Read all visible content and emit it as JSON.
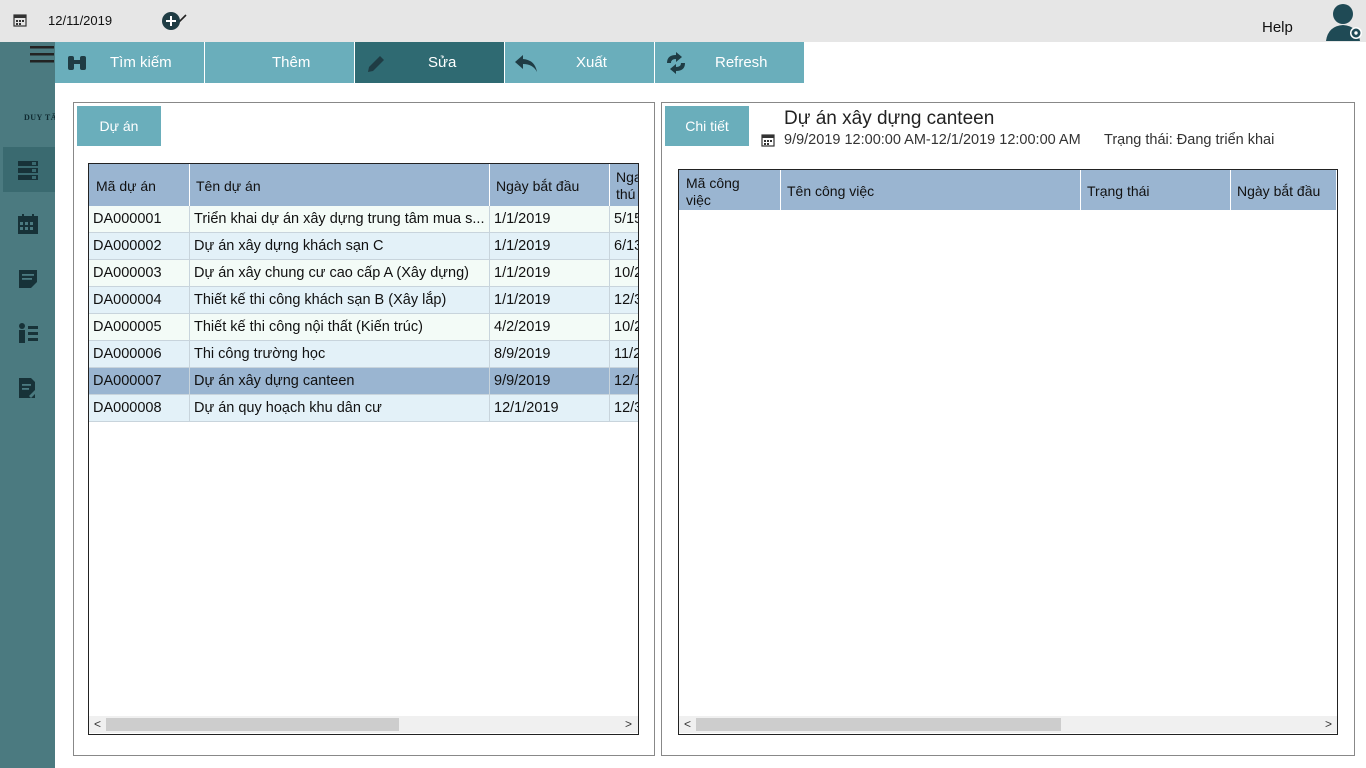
{
  "topbar": {
    "date": "12/11/2019",
    "help": "Help"
  },
  "sidebar": {
    "brand": "DUY TÂN"
  },
  "toolbar": {
    "buttons": [
      {
        "label": "Tìm kiếm",
        "icon": "binoculars-icon"
      },
      {
        "label": "Thêm",
        "icon": "plus-circle-icon"
      },
      {
        "label": "Sửa",
        "icon": "pencil-icon"
      },
      {
        "label": "Xuất",
        "icon": "reply-arrow-icon"
      },
      {
        "label": "Refresh",
        "icon": "refresh-icon"
      }
    ]
  },
  "projects": {
    "tab": "Dự án",
    "columns": [
      "Mã dự án",
      "Tên dự án",
      "Ngày bắt đầu",
      "Nga thú"
    ],
    "rows": [
      {
        "id": "DA000001",
        "name": "Triển khai dự án xây dựng trung tâm mua s...",
        "start": "1/1/2019",
        "end": "5/15"
      },
      {
        "id": "DA000002",
        "name": "Dự án xây dựng khách sạn C",
        "start": "1/1/2019",
        "end": "6/13"
      },
      {
        "id": "DA000003",
        "name": "Dự án xây chung cư cao cấp A (Xây dựng)",
        "start": "1/1/2019",
        "end": "10/2"
      },
      {
        "id": "DA000004",
        "name": "Thiết kế thi công khách sạn B (Xây lắp)",
        "start": "1/1/2019",
        "end": "12/3"
      },
      {
        "id": "DA000005",
        "name": "Thiết kế thi công nội thất (Kiến trúc)",
        "start": "4/2/2019",
        "end": "10/2"
      },
      {
        "id": "DA000006",
        "name": "Thi công trường học",
        "start": "8/9/2019",
        "end": "11/2"
      },
      {
        "id": "DA000007",
        "name": "Dự án xây dựng canteen",
        "start": "9/9/2019",
        "end": "12/1"
      },
      {
        "id": "DA000008",
        "name": "Dự án quy hoạch khu dân cư",
        "start": "12/1/2019",
        "end": "12/3"
      }
    ],
    "selected_index": 6,
    "scroll": {
      "left": "<",
      "right": ">"
    }
  },
  "detail": {
    "tab": "Chi tiết",
    "title": "Dự án xây dựng canteen",
    "range": "9/9/2019 12:00:00 AM-12/1/2019 12:00:00 AM",
    "status": "Trạng thái: Đang triển khai",
    "columns": [
      "Mã công việc",
      "Tên công việc",
      "Trạng thái",
      "Ngày bắt đầu"
    ],
    "scroll": {
      "left": "<",
      "right": ">"
    }
  },
  "colors": {
    "accent": "#6aaebb",
    "sidebar": "#4b7a80",
    "active": "#2f6a72",
    "header": "#9ab5d1"
  }
}
